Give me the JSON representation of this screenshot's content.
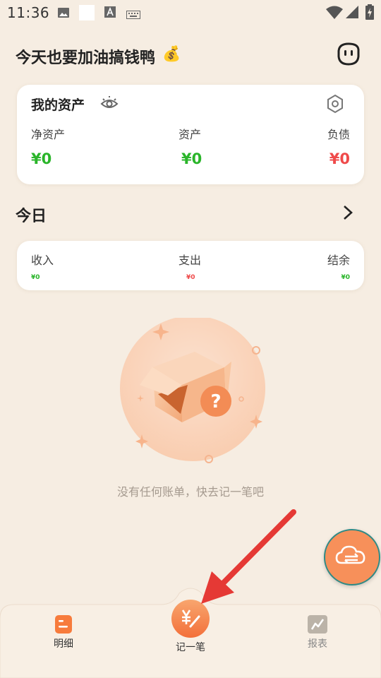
{
  "status_bar": {
    "time": "11:36"
  },
  "header": {
    "title": "今天也要加油搞钱鸭",
    "emoji": "💰"
  },
  "assets_card": {
    "title": "我的资产",
    "stats": [
      {
        "label": "净资产",
        "value": "¥0"
      },
      {
        "label": "资产",
        "value": "¥0"
      },
      {
        "label": "负债",
        "value": "¥0"
      }
    ]
  },
  "today": {
    "title": "今日",
    "stats": [
      {
        "label": "收入",
        "value": "¥0"
      },
      {
        "label": "支出",
        "value": "¥0"
      },
      {
        "label": "结余",
        "value": "¥0"
      }
    ]
  },
  "empty_state": {
    "text": "没有任何账单，快去记一笔吧"
  },
  "nav": {
    "items": [
      {
        "label": "明细"
      },
      {
        "label": "记一笔"
      },
      {
        "label": "报表"
      }
    ]
  },
  "colors": {
    "background": "#f6ede2",
    "accent": "#f7905a",
    "income_green": "#2ab52a",
    "expense_red": "#ef4a4a",
    "annotation_red": "#e53935"
  }
}
